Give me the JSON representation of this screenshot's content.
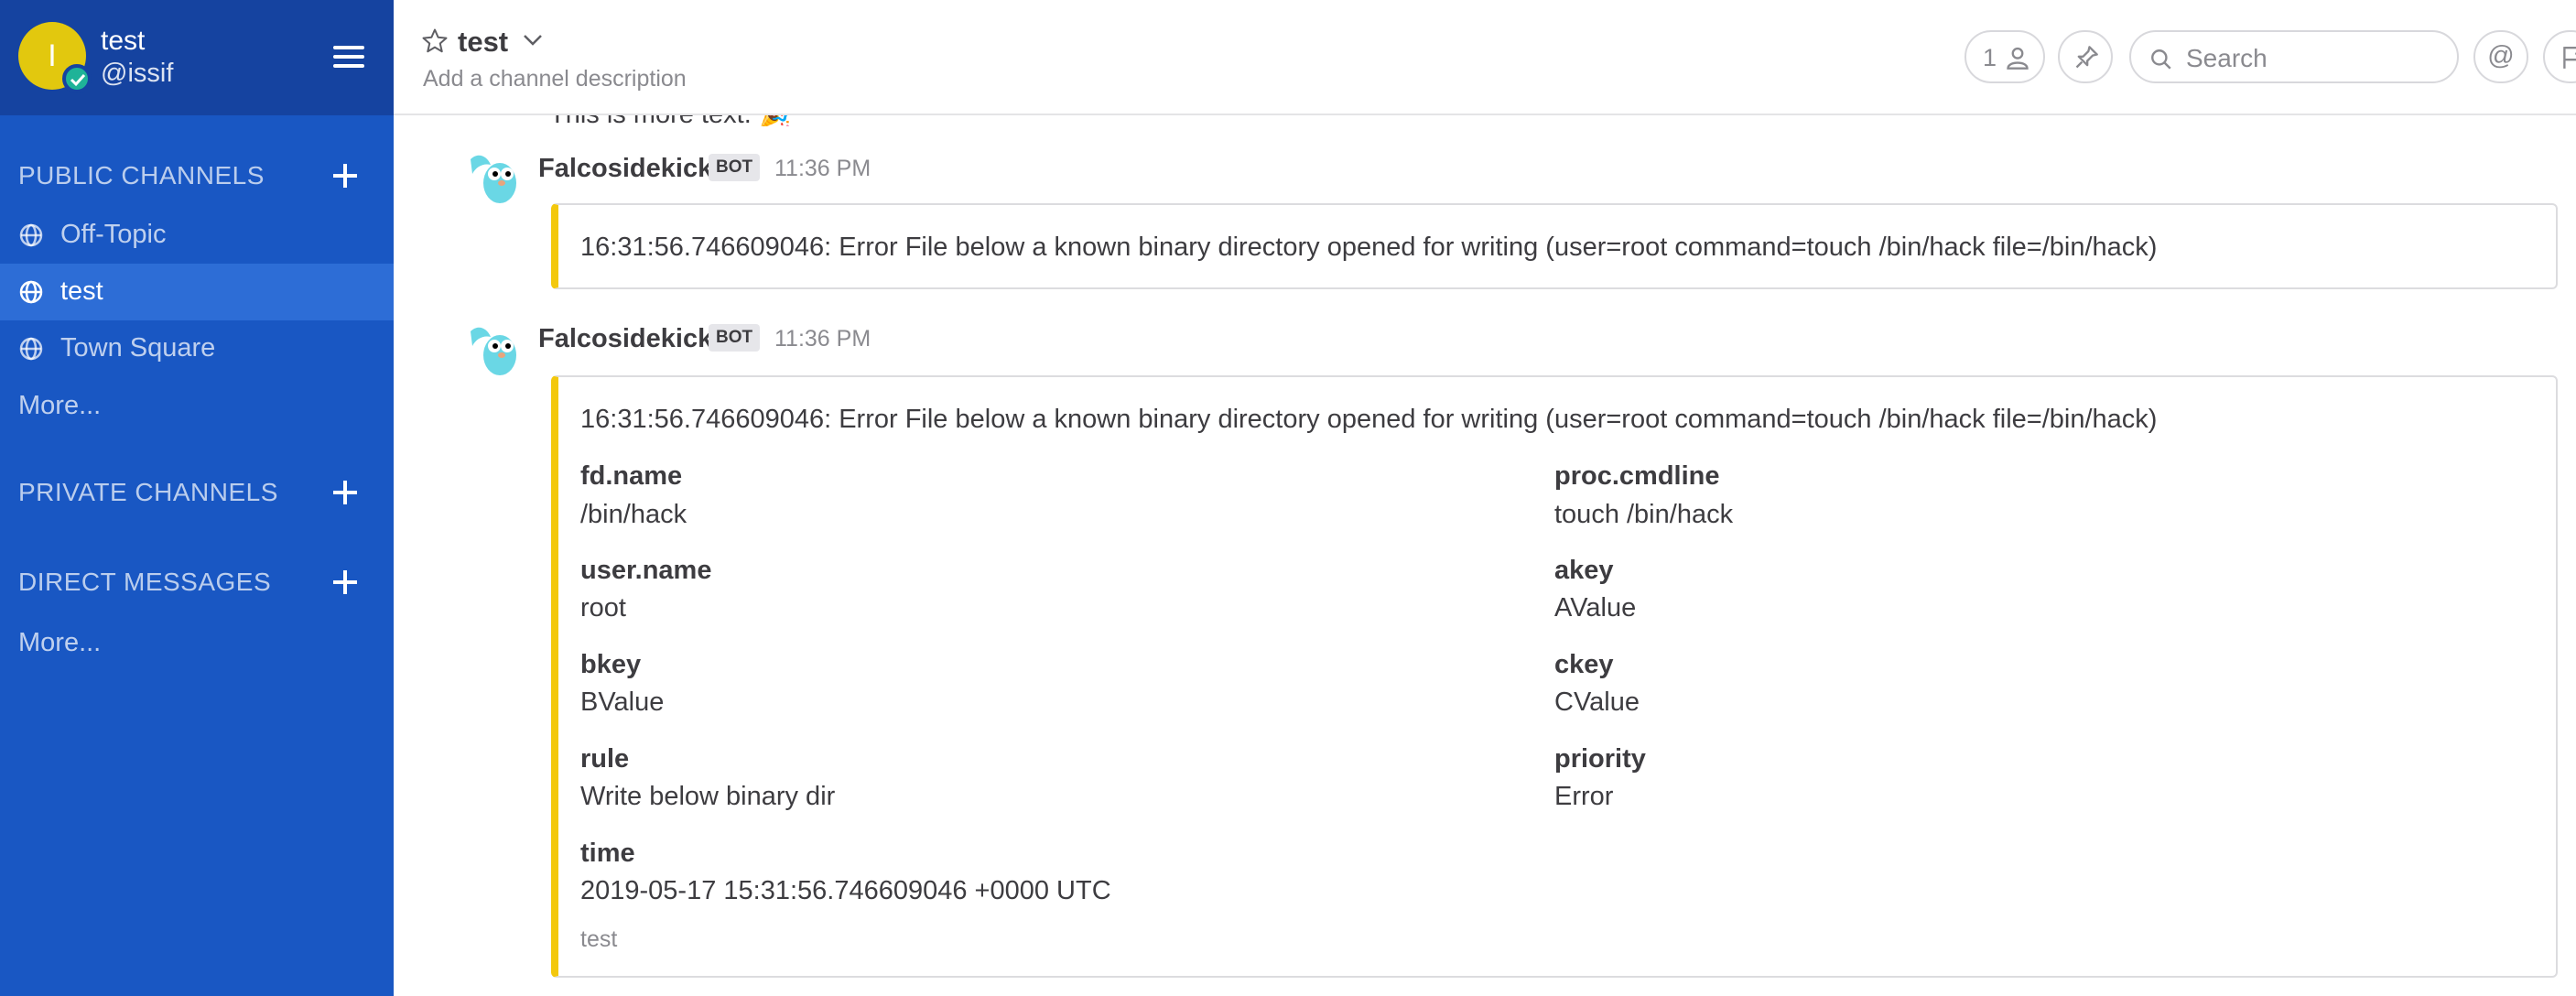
{
  "sidebar": {
    "avatar_letter": "I",
    "team_name": "test",
    "username": "@issif",
    "public_channels_title": "PUBLIC CHANNELS",
    "channels": [
      {
        "label": "Off-Topic"
      },
      {
        "label": "test"
      },
      {
        "label": "Town Square"
      }
    ],
    "public_more": "More...",
    "private_channels_title": "PRIVATE CHANNELS",
    "direct_messages_title": "DIRECT MESSAGES",
    "dm_more": "More..."
  },
  "header": {
    "channel_name": "test",
    "channel_description": "Add a channel description",
    "member_count": "1",
    "search_placeholder": "Search",
    "mention_symbol": "@"
  },
  "messages": {
    "previous_text": "This is more text. 🎉",
    "items": [
      {
        "author": "Falcosidekick",
        "bot_tag": "BOT",
        "time": "11:36 PM",
        "text": "16:31:56.746609046: Error File below a known binary directory opened for writing (user=root command=touch /bin/hack file=/bin/hack)"
      },
      {
        "author": "Falcosidekick",
        "bot_tag": "BOT",
        "time": "11:36 PM",
        "text": "16:31:56.746609046: Error File below a known binary directory opened for writing (user=root command=touch /bin/hack file=/bin/hack)",
        "fields": [
          {
            "title": "fd.name",
            "value": "/bin/hack"
          },
          {
            "title": "proc.cmdline",
            "value": "touch /bin/hack"
          },
          {
            "title": "user.name",
            "value": "root"
          },
          {
            "title": "akey",
            "value": "AValue"
          },
          {
            "title": "bkey",
            "value": "BValue"
          },
          {
            "title": "ckey",
            "value": "CValue"
          },
          {
            "title": "rule",
            "value": "Write below binary dir"
          },
          {
            "title": "priority",
            "value": "Error"
          },
          {
            "title": "time",
            "value": "2019-05-17 15:31:56.746609046 +0000 UTC"
          }
        ],
        "footer": "test"
      }
    ]
  },
  "colors": {
    "sidebar_bg": "#1957c3",
    "sidebar_header_bg": "#1543a0",
    "active_channel_bg": "#2d6dd6",
    "attachment_accent": "#f3c80d",
    "avatar_bg": "#e2c80e",
    "status_online": "#1fb398"
  }
}
